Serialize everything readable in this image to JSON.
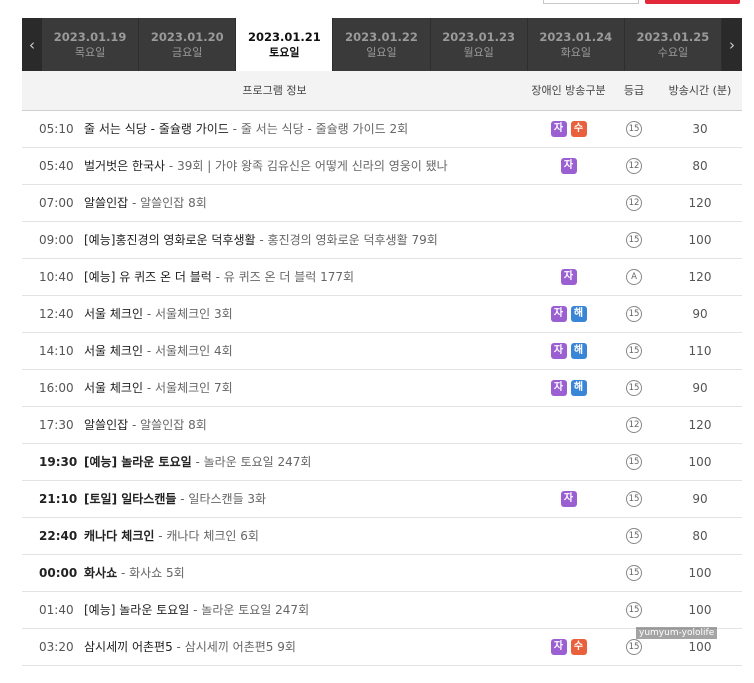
{
  "nav": {
    "prev_icon": "chevron-left-icon",
    "next_icon": "chevron-right-icon",
    "days": [
      {
        "date": "2023.01.19",
        "weekday": "목요일",
        "active": false
      },
      {
        "date": "2023.01.20",
        "weekday": "금요일",
        "active": false
      },
      {
        "date": "2023.01.21",
        "weekday": "토요일",
        "active": true
      },
      {
        "date": "2023.01.22",
        "weekday": "일요일",
        "active": false
      },
      {
        "date": "2023.01.23",
        "weekday": "월요일",
        "active": false
      },
      {
        "date": "2023.01.24",
        "weekday": "화요일",
        "active": false
      },
      {
        "date": "2023.01.25",
        "weekday": "수요일",
        "active": false
      }
    ]
  },
  "table": {
    "headers": {
      "program": "프로그램 정보",
      "accessibility": "장애인 방송구분",
      "grade": "등급",
      "duration": "방송시간 (분)"
    },
    "rows": [
      {
        "time": "05:10",
        "title": "줄 서는 식당 - 줄슐랭 가이드",
        "sub": "줄 서는 식당 - 줄슐랭 가이드 2회",
        "badges": [
          "자",
          "수"
        ],
        "grade": "15",
        "duration": "30",
        "bold": false
      },
      {
        "time": "05:40",
        "title": "벌거벗은 한국사",
        "sub": "39회 | 가야 왕족 김유신은 어떻게 신라의 영웅이 됐나",
        "badges": [
          "자"
        ],
        "grade": "12",
        "duration": "80",
        "bold": false
      },
      {
        "time": "07:00",
        "title": "알쓸인잡",
        "sub": "알쓸인잡 8회",
        "badges": [],
        "grade": "12",
        "duration": "120",
        "bold": false
      },
      {
        "time": "09:00",
        "title": "[예능]홍진경의 영화로운 덕후생활",
        "sub": "홍진경의 영화로운 덕후생활 79회",
        "badges": [],
        "grade": "15",
        "duration": "100",
        "bold": false
      },
      {
        "time": "10:40",
        "title": "[예능] 유 퀴즈 온 더 블럭",
        "sub": "유 퀴즈 온 더 블럭 177회",
        "badges": [
          "자"
        ],
        "grade": "A",
        "duration": "120",
        "bold": false
      },
      {
        "time": "12:40",
        "title": "서울 체크인",
        "sub": "서울체크인 3회",
        "badges": [
          "자",
          "해"
        ],
        "grade": "15",
        "duration": "90",
        "bold": false
      },
      {
        "time": "14:10",
        "title": "서울 체크인",
        "sub": "서울체크인 4회",
        "badges": [
          "자",
          "해"
        ],
        "grade": "15",
        "duration": "110",
        "bold": false
      },
      {
        "time": "16:00",
        "title": "서울 체크인",
        "sub": "서울체크인 7회",
        "badges": [
          "자",
          "해"
        ],
        "grade": "15",
        "duration": "90",
        "bold": false
      },
      {
        "time": "17:30",
        "title": "알쓸인잡",
        "sub": "알쓸인잡 8회",
        "badges": [],
        "grade": "12",
        "duration": "120",
        "bold": false
      },
      {
        "time": "19:30",
        "title": "[예능] 놀라운 토요일",
        "sub": "놀라운 토요일 247회",
        "badges": [],
        "grade": "15",
        "duration": "100",
        "bold": true
      },
      {
        "time": "21:10",
        "title": "[토일] 일타스캔들",
        "sub": "일타스캔들 3화",
        "badges": [
          "자"
        ],
        "grade": "15",
        "duration": "90",
        "bold": true
      },
      {
        "time": "22:40",
        "title": "캐나다 체크인",
        "sub": "캐나다 체크인 6회",
        "badges": [],
        "grade": "15",
        "duration": "80",
        "bold": true
      },
      {
        "time": "00:00",
        "title": "화사쇼",
        "sub": "화사쇼 5회",
        "badges": [],
        "grade": "15",
        "duration": "100",
        "bold": true
      },
      {
        "time": "01:40",
        "title": "[예능] 놀라운 토요일",
        "sub": "놀라운 토요일 247회",
        "badges": [],
        "grade": "15",
        "duration": "100",
        "bold": false
      },
      {
        "time": "03:20",
        "title": "삼시세끼 어촌편5",
        "sub": "삼시세끼 어촌편5 9회",
        "badges": [
          "자",
          "수"
        ],
        "grade": "15",
        "duration": "100",
        "bold": false
      }
    ]
  },
  "watermark": "yumyum-yololife",
  "colors": {
    "badge_ja": "#9a5fd1",
    "badge_su": "#e8603c",
    "badge_hae": "#3a86d6",
    "day_bar": "#3a3a3a",
    "accent_red": "#e3283a"
  }
}
